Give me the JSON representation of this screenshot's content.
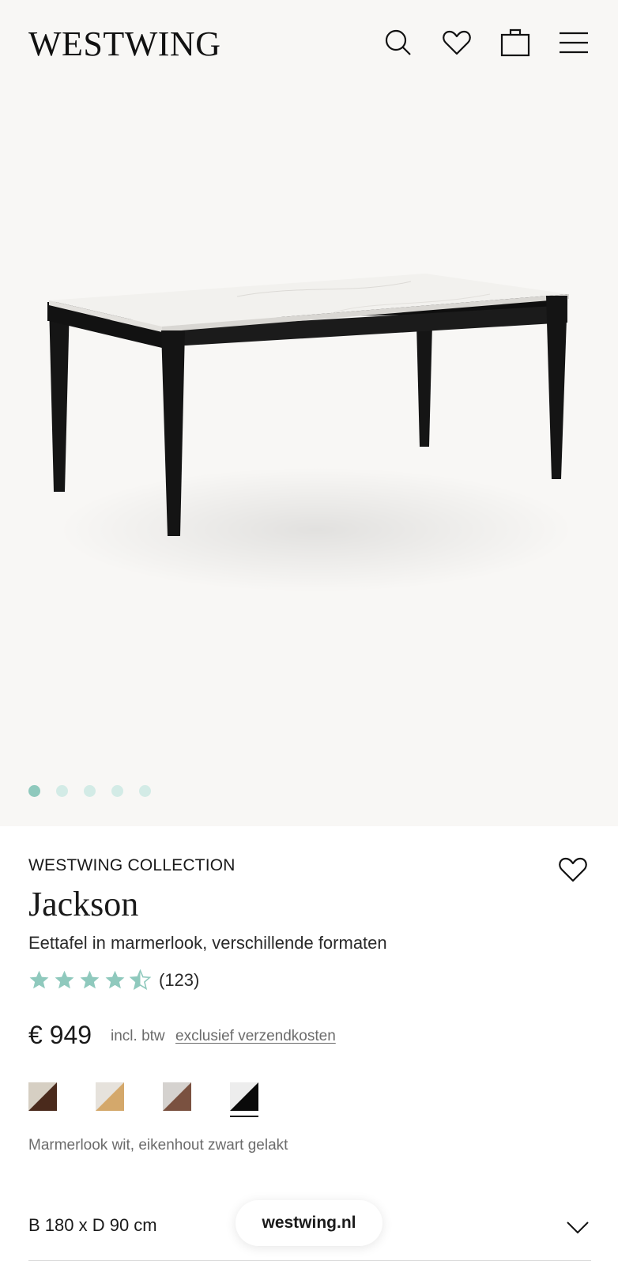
{
  "header": {
    "logo": "WESTWING",
    "icons": [
      "search-icon",
      "heart-icon",
      "shopping-bag-icon",
      "menu-icon"
    ]
  },
  "gallery": {
    "image_count": 5,
    "active_index": 0,
    "image_alt": "table-product-image"
  },
  "product": {
    "brand": "WESTWING COLLECTION",
    "name": "Jackson",
    "subtitle": "Eettafel in marmerlook, verschillende formaten",
    "rating": 4.5,
    "rating_max": 5,
    "reviews": "(123)",
    "price": "€ 949",
    "vat_text": "incl. btw",
    "shipping_text": "exclusief verzendkosten",
    "selected_color": "Marmerlook wit, eikenhout zwart gelakt",
    "size_label": "B 180 x D 90 cm"
  },
  "swatches": [
    {
      "top": "#d6cfc3",
      "bottom": "#4a2a1c"
    },
    {
      "top": "#e6e2dc",
      "bottom": "#d4a86b"
    },
    {
      "top": "#d5d2cf",
      "bottom": "#7a5140"
    },
    {
      "top": "#ededed",
      "bottom": "#0a0a0a",
      "selected": true
    }
  ],
  "overlay": {
    "site_pill": "westwing.nl"
  },
  "colors": {
    "accent": "#8fc9bd",
    "dot_inactive": "#d3ebe6",
    "background_gallery": "#f8f7f5"
  }
}
